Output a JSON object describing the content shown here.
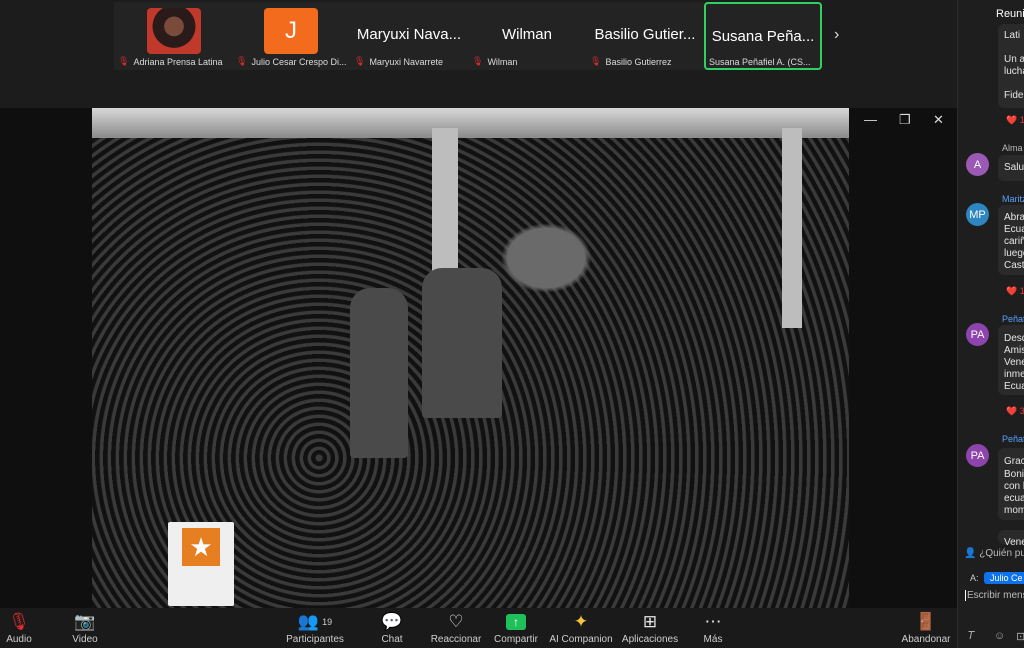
{
  "participants": [
    {
      "display": "",
      "name": "Adriana Prensa Latina",
      "avatar": "photo"
    },
    {
      "display": "J",
      "name": "Julio Cesar Crespo Di...",
      "avatar": "letter"
    },
    {
      "display": "Maryuxi Nava...",
      "name": "Maryuxi Navarrete",
      "avatar": "none"
    },
    {
      "display": "Wilman",
      "name": "Wilman",
      "avatar": "none"
    },
    {
      "display": "Basilio Gutier...",
      "name": "Basilio Gutierrez",
      "avatar": "none"
    },
    {
      "display": "Susana Peña...",
      "name": "Susana Peñafiel A. (CS...",
      "avatar": "none",
      "active": true
    }
  ],
  "toolbar": {
    "audio": "Audio",
    "video": "Video",
    "participants": "Participantes",
    "participants_count": "19",
    "chat": "Chat",
    "react": "Reaccionar",
    "share": "Compartir",
    "ai": "AI Companion",
    "apps": "Aplicaciones",
    "more": "Más",
    "leave": "Abandonar"
  },
  "chat": {
    "header": "Reunic",
    "messages": [
      {
        "sender": "",
        "lines": [
          "Lati",
          "",
          "Un a",
          "lucha",
          "",
          "Fidel"
        ],
        "reaction": "❤️ 1"
      },
      {
        "sender": "Alma",
        "avatar": "A",
        "avatar_color": "#9b59b6",
        "lines": [
          "Salud"
        ],
        "reaction": ""
      },
      {
        "sender": "Maritz",
        "avatar": "MP",
        "avatar_color": "#2e86c1",
        "lines": [
          "Abra",
          "Ecua",
          "cariñ",
          "luego",
          "Castr"
        ],
        "reaction": "❤️ 1"
      },
      {
        "sender": "Peñaf",
        "avatar": "PA",
        "avatar_color": "#8e44ad",
        "lines": [
          "Desd",
          "Amis",
          "Vene",
          "inme",
          "Ecua"
        ],
        "reaction": "❤️ 3"
      },
      {
        "sender": "Peñaf",
        "avatar": "PA",
        "avatar_color": "#8e44ad",
        "lines": [
          "Grac",
          "Boni",
          "con l",
          "ecua",
          "mom"
        ],
        "reaction": ""
      },
      {
        "sender": "",
        "lines": [
          "Vene"
        ],
        "reaction": ""
      }
    ],
    "who_can_see": "¿Quién pu",
    "to_label": "A:",
    "to_value": "Julio Ce",
    "input_placeholder": "Escribir mens"
  },
  "colors": {
    "active_border": "#2fd262",
    "share_green": "#1fbf5a",
    "mute_red": "#e02d2d",
    "accent_blue": "#0e72ed"
  }
}
